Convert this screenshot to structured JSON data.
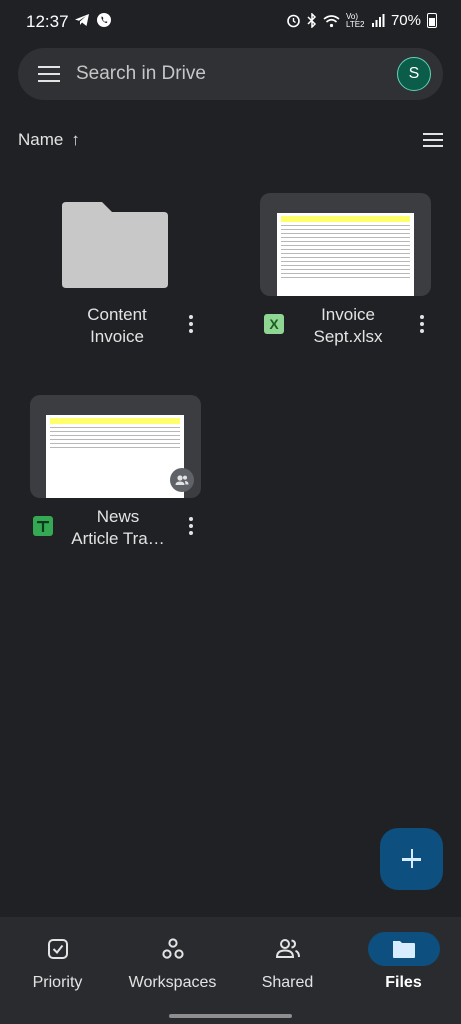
{
  "status_bar": {
    "time": "12:37",
    "network": "Vo) LTE2",
    "battery": "70%"
  },
  "search": {
    "placeholder": "Search in Drive",
    "avatar_letter": "S"
  },
  "sort": {
    "label": "Name",
    "direction_glyph": "↑"
  },
  "files": [
    {
      "name_line1": "Content",
      "name_line2": "Invoice",
      "type": "folder"
    },
    {
      "name_line1": "Invoice",
      "name_line2": "Sept.xlsx",
      "type": "xlsx",
      "type_letter": "X"
    },
    {
      "name_line1": "News",
      "name_line2": "Article Tra…",
      "type": "google-sheet",
      "shared": true
    }
  ],
  "bottom_nav": [
    {
      "label": "Priority",
      "icon": "priority-check-icon",
      "active": false
    },
    {
      "label": "Workspaces",
      "icon": "workspaces-icon",
      "active": false
    },
    {
      "label": "Shared",
      "icon": "people-icon",
      "active": false
    },
    {
      "label": "Files",
      "icon": "folder-icon",
      "active": true
    }
  ],
  "colors": {
    "background": "#202124",
    "accent": "#0d4f7e",
    "surface": "#303134"
  }
}
